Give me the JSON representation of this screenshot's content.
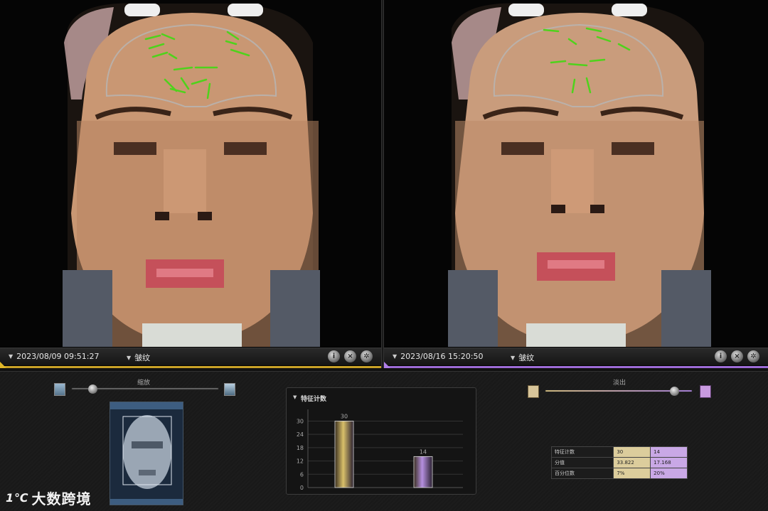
{
  "left_panel": {
    "timestamp": "2023/08/09 09:51:27",
    "mode": "皱纹",
    "accent_color": "#c9a227"
  },
  "right_panel": {
    "timestamp": "2023/08/16 15:20:50",
    "mode": "皱纹",
    "accent_color": "#9d6bd6"
  },
  "zoom": {
    "label": "缩放",
    "level": 0.14
  },
  "fade": {
    "label": "淡出",
    "level": 0.88
  },
  "chart": {
    "title": "特征计数"
  },
  "chart_data": {
    "type": "bar",
    "title": "特征计数",
    "categories": [
      "",
      ""
    ],
    "values": [
      30,
      14
    ],
    "data_labels": [
      "30",
      "14"
    ],
    "yticks": [
      0,
      6,
      12,
      18,
      24,
      30
    ],
    "ylim": [
      0,
      34
    ],
    "colors": [
      "#d9c06a",
      "#b58fe0"
    ],
    "grid": true
  },
  "stats_table": {
    "rows": [
      {
        "label": "特征计数",
        "v1": "30",
        "v2": "14"
      },
      {
        "label": "分值",
        "v1": "33.822",
        "v2": "17.168"
      },
      {
        "label": "百分位数",
        "v1": "7%",
        "v2": "20%"
      }
    ]
  },
  "logo": {
    "mark": "1℃",
    "text": "大数跨境"
  }
}
